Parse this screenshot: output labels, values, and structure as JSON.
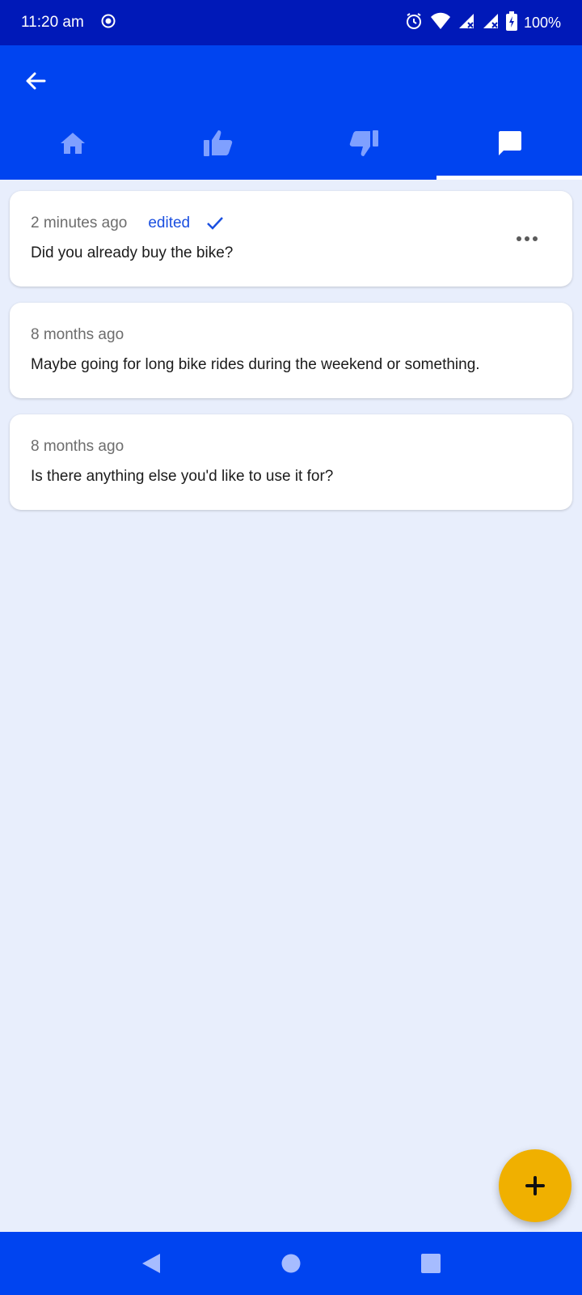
{
  "status_bar": {
    "time": "11:20 am",
    "battery": "100%",
    "icons": [
      "record-icon",
      "alarm-icon",
      "wifi-icon",
      "signal-icon",
      "signal-icon",
      "battery-charging-icon"
    ]
  },
  "tabs": [
    {
      "icon": "home-icon",
      "active": false
    },
    {
      "icon": "thumbs-up-icon",
      "active": false
    },
    {
      "icon": "thumbs-down-icon",
      "active": false
    },
    {
      "icon": "comment-icon",
      "active": true
    }
  ],
  "comments": [
    {
      "time": "2 minutes ago",
      "edited": "edited",
      "text": "Did you already buy the bike?"
    },
    {
      "time": "8 months ago",
      "text": "Maybe going for long bike rides during the weekend or something."
    },
    {
      "time": "8 months ago",
      "text": "Is there anything else you'd like to use it for?"
    }
  ],
  "colors": {
    "status_bar": "#0019b8",
    "app_bar": "#0044f0",
    "background": "#e8eefc",
    "fab": "#f0b000",
    "accent_text": "#1a4fe0",
    "inactive_icon": "#7fa0ff"
  }
}
